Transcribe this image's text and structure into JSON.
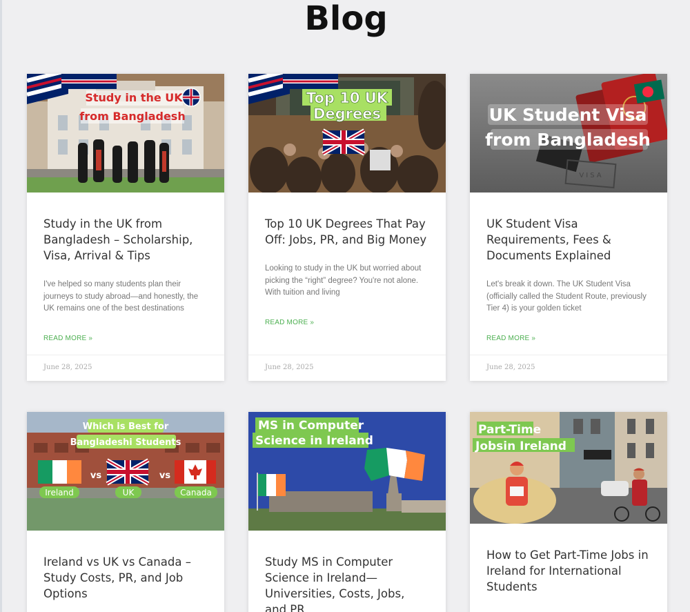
{
  "page": {
    "title": "Blog"
  },
  "posts": [
    {
      "thumb_line1": "Study in the UK",
      "thumb_line2": "from Bangladesh",
      "title": "Study in the UK from Bangladesh – Scholarship, Visa, Arrival & Tips",
      "excerpt": "I've helped so many students plan their journeys to study abroad—and honestly, the UK remains one of the best destinations",
      "read_more": "READ MORE »",
      "date": "June 28, 2025"
    },
    {
      "thumb_line1": "Top 10 UK",
      "thumb_line2": "Degrees",
      "title": "Top 10 UK Degrees That Pay Off: Jobs, PR, and Big Money",
      "excerpt": "Looking to study in the UK but worried about picking the “right” degree? You're not alone. With tuition and living",
      "read_more": "READ MORE »",
      "date": "June 28, 2025"
    },
    {
      "thumb_line1": "UK Student Visa",
      "thumb_line2": "from Bangladesh",
      "thumb_stamp": "VISA",
      "title": "UK Student Visa Requirements, Fees & Documents Explained",
      "excerpt": "Let's break it down. The UK Student Visa (officially called the Student Route, previously Tier 4) is your golden ticket",
      "read_more": "READ MORE »",
      "date": "June 28, 2025"
    },
    {
      "thumb_line1": "Which is Best for",
      "thumb_line2": "Bangladeshi Students",
      "thumb_vs": "vs",
      "thumb_labels": [
        "Ireland",
        "UK",
        "Canada"
      ],
      "title": "Ireland vs UK vs Canada – Study Costs, PR, and Job Options"
    },
    {
      "thumb_line1": "MS in Computer",
      "thumb_line2": "Science in Ireland",
      "title": "Study MS in Computer Science in Ireland—Universities, Costs, Jobs, and PR"
    },
    {
      "thumb_line1": "Part-Time",
      "thumb_line2": "Jobsin Ireland",
      "title": "How to Get Part-Time Jobs in Ireland for International Students"
    }
  ],
  "colors": {
    "accent": "#4caf50",
    "highlight": "#a8e063"
  }
}
